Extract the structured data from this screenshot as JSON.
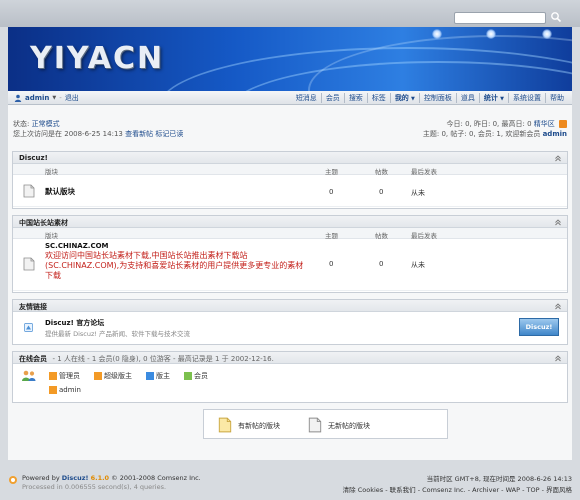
{
  "header": {
    "logo": "YIYACN",
    "user": "admin",
    "logout": "退出",
    "nav": [
      "短消息",
      "会员",
      "搜索",
      "标签",
      "我的",
      "控制面板",
      "道具",
      "统计",
      "系统设置",
      "帮助"
    ]
  },
  "status": {
    "state_label": "状态:",
    "state_value": "正常模式",
    "last_visit_label": "您上次访问是在",
    "last_visit_time": "2008-6-25 14:13",
    "new_posts_link": "查看新帖",
    "mark_read_link": "标记已读",
    "today": "今日: 0, 昨日: 0, 最高日: 0",
    "digest": "精华区",
    "stats": "主题: 0, 帖子: 0, 会员: 1, 欢迎新会员",
    "new_member": "admin"
  },
  "categories": [
    {
      "title": "Discuz!",
      "cols": {
        "forum": "版块",
        "threads": "主题",
        "posts": "帖数",
        "lastpost": "最后发表"
      },
      "forums": [
        {
          "name": "默认版块",
          "threads": "0",
          "posts": "0",
          "lastpost": "从未"
        }
      ]
    },
    {
      "title": "中国站长站素材",
      "cols": {
        "forum": "版块",
        "threads": "主题",
        "posts": "帖数",
        "lastpost": "最后发表"
      },
      "forums": [
        {
          "name": "SC.CHINAZ.COM",
          "threads": "0",
          "posts": "0",
          "lastpost": "从未",
          "desc": "欢迎访问中国站长站素材下载,中国站长站推出素材下载站(SC.CHINAZ.COM),为支持和喜爱站长素材的用户提供更多更专业的素材下载"
        }
      ]
    }
  ],
  "links": {
    "title": "友情链接",
    "name": "Discuz! 官方论坛",
    "desc": "提供最新 Discuz! 产品新闻、软件下载与技术交流",
    "badge": "Discuz!"
  },
  "online": {
    "title": "在线会员",
    "summary": "- 1 人在线 - 1 会员(0 隐身), 0 位游客 - 最高记录是 1 于 2002-12-16.",
    "groups": [
      "管理员",
      "超级版主",
      "版主",
      "会员"
    ],
    "users": [
      "admin"
    ]
  },
  "legend": {
    "new": "有新帖的版块",
    "none": "无新帖的版块"
  },
  "footer": {
    "powered": "Powered by",
    "product": "Discuz!",
    "version": "6.1.0",
    "copyright": "© 2001-2008 Comsenz Inc.",
    "processed": "Processed in 0.006555 second(s), 4 queries.",
    "timezone": "当前时区 GMT+8, 现在时间是 2008-6-26 14:13",
    "links": "清除 Cookies - 联系我们 - Comsenz Inc. - Archiver - WAP - TOP - 界面风格"
  },
  "colors": {
    "banner": "#1559c6",
    "accent_red": "#c3211b",
    "link": "#1d4b8c"
  }
}
